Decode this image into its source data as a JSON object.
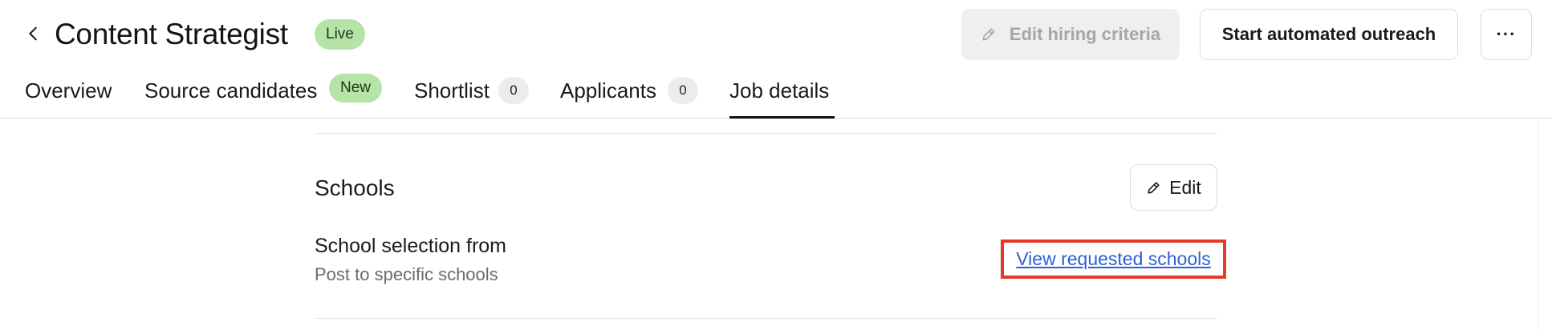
{
  "header": {
    "title": "Content Strategist",
    "status_badge": "Live",
    "edit_criteria_label": "Edit hiring criteria",
    "outreach_label": "Start automated outreach",
    "more_label": "···"
  },
  "tabs": [
    {
      "label": "Overview",
      "active": false
    },
    {
      "label": "Source candidates",
      "badge": "New",
      "active": false
    },
    {
      "label": "Shortlist",
      "count": "0",
      "active": false
    },
    {
      "label": "Applicants",
      "count": "0",
      "active": false
    },
    {
      "label": "Job details",
      "active": true
    }
  ],
  "section": {
    "title": "Schools",
    "edit_label": "Edit",
    "field_label": "School selection from",
    "field_value": "Post to specific schools",
    "link_label": "View requested schools"
  },
  "icons": {
    "back": "chevron-left-icon",
    "pencil": "pencil-icon"
  },
  "colors": {
    "badge_green": "#b6e3a6",
    "link_blue": "#2f5fd6",
    "highlight_red": "#e53a2a"
  }
}
